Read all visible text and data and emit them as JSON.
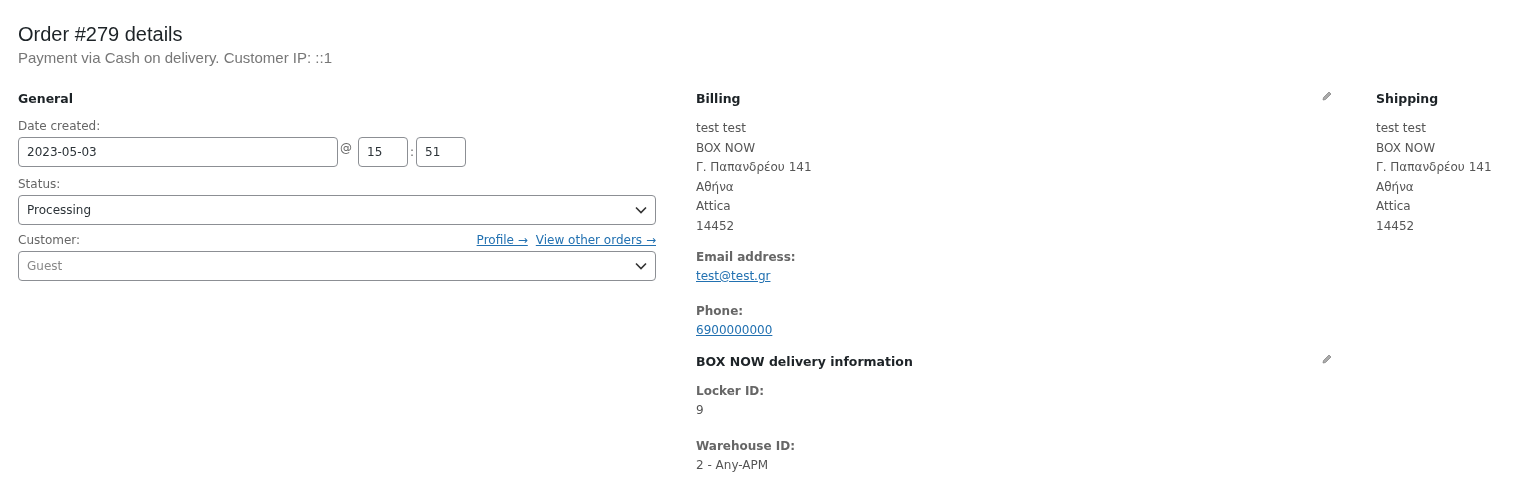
{
  "title": "Order #279 details",
  "subtitle": "Payment via Cash on delivery. Customer IP: ::1",
  "general": {
    "heading": "General",
    "date_label": "Date created:",
    "date": "2023-05-03",
    "at": "@",
    "hour": "15",
    "colon": ":",
    "minute": "51",
    "status_label": "Status:",
    "status": "Processing",
    "customer_label": "Customer:",
    "links": [
      "Profile →",
      "View other orders →"
    ],
    "customer_placeholder": "Guest"
  },
  "billing": {
    "heading": "Billing",
    "address": [
      "test test",
      "BOX NOW",
      "Γ. Παπανδρέου 141",
      "Αθήνα",
      "Attica",
      "14452"
    ],
    "fields": [
      {
        "label": "Email address:",
        "value": "test@test.gr",
        "kind": "link"
      },
      {
        "label": "Phone:",
        "value": "6900000000",
        "kind": "link"
      }
    ]
  },
  "delivery": {
    "heading": "BOX NOW delivery information",
    "fields": [
      {
        "label": "Locker ID:",
        "value": "9",
        "kind": "text"
      },
      {
        "label": "Warehouse ID:",
        "value": "2 - Any-APM",
        "kind": "text"
      }
    ]
  },
  "shipping": {
    "heading": "Shipping",
    "address": [
      "test test",
      "BOX NOW",
      "Γ. Παπανδρέου 141",
      "Αθήνα",
      "Attica",
      "14452"
    ]
  }
}
